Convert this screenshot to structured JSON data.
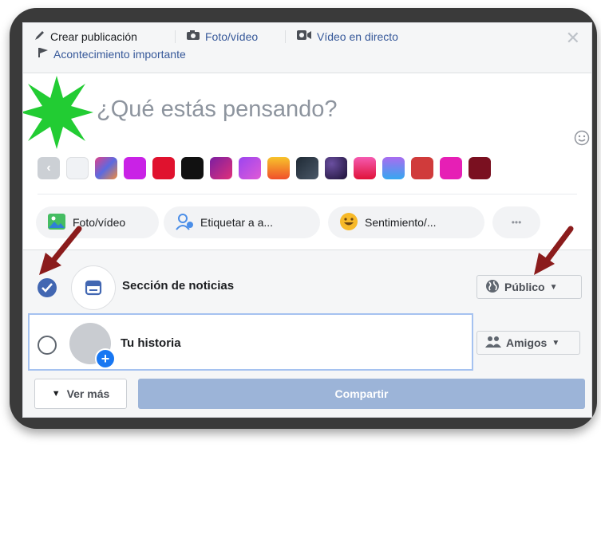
{
  "header": {
    "create_post": "Crear publicación",
    "photo_video": "Foto/vídeo",
    "live_video": "Vídeo en directo",
    "life_event": "Acontecimiento importante"
  },
  "composer": {
    "prompt": "¿Qué estás pensando?",
    "swatch_colors": [
      "#f0f2f5",
      "#c25bd6",
      "#c922e6",
      "#e0122e",
      "#111111",
      "#b0217e",
      "#a64de4",
      "#f6a01a",
      "#2f3a45",
      "#2c1a4c",
      "#e72d63",
      "#5a9ef0",
      "#d03b3b",
      "#e61fb5",
      "#7a1020"
    ]
  },
  "actions": {
    "photo_video": "Foto/vídeo",
    "tag": "Etiquetar a a...",
    "feeling": "Sentimiento/...",
    "more": "•••"
  },
  "audience": {
    "news_feed": "Sección de noticias",
    "public": "Público",
    "your_story": "Tu historia",
    "friends": "Amigos"
  },
  "footer": {
    "see_more": "Ver más",
    "share": "Compartir"
  },
  "colors": {
    "accent": "#4267b2",
    "link": "#365899",
    "share_disabled": "#9cb4d8",
    "annotation_arrow": "#8b1c1c",
    "annotation_star": "#22cc33"
  }
}
